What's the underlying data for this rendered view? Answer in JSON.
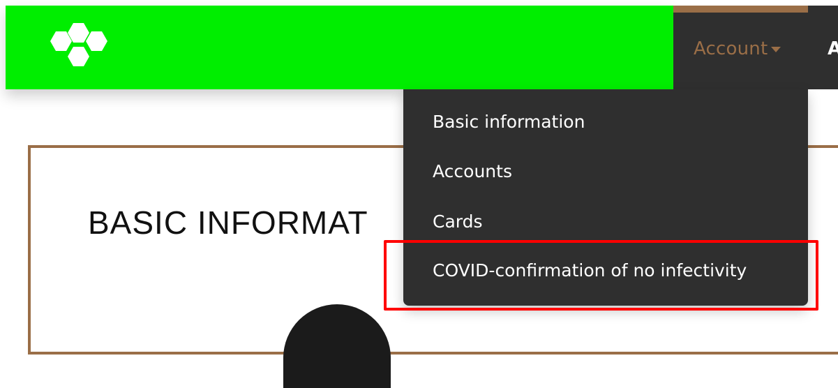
{
  "header": {
    "logo_icon": "hexagon-cluster-logo",
    "account_label": "Account",
    "next_menu_label": "A"
  },
  "dropdown": {
    "items": [
      {
        "label": "Basic information"
      },
      {
        "label": "Accounts"
      },
      {
        "label": "Cards"
      },
      {
        "label": "COVID-confirmation of no infectivity"
      }
    ]
  },
  "page": {
    "title": "BASIC INFORMAT"
  },
  "colors": {
    "header_green": "#00ee00",
    "dark_nav": "#2f2f2f",
    "brown_accent": "#9a6e47",
    "highlight_red": "#ff0000"
  }
}
